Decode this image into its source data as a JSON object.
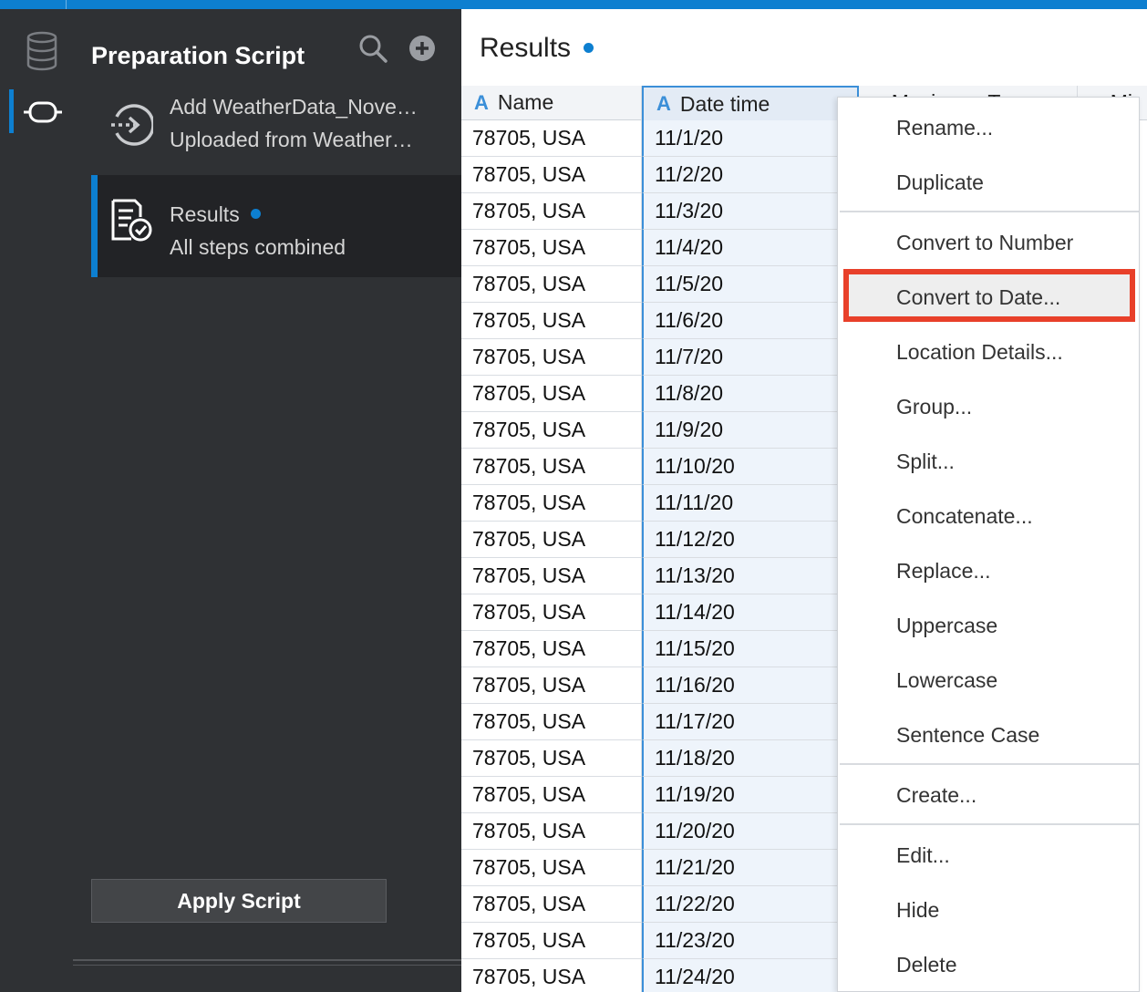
{
  "colors": {
    "accent": "#0d7fd0",
    "highlight": "#e8402a",
    "panel_bg": "#2f3134"
  },
  "left_rail": {
    "icons": [
      "database-icon",
      "data-flow-icon"
    ]
  },
  "script_panel": {
    "title": "Preparation Script",
    "steps": [
      {
        "title": "Add WeatherData_Nove…",
        "subtitle": "Uploaded from Weather…",
        "icon": "add-data-icon"
      },
      {
        "title": "Results",
        "subtitle": "All steps combined",
        "icon": "results-check-icon"
      }
    ],
    "apply_label": "Apply Script"
  },
  "main": {
    "title": "Results",
    "columns": [
      "Name",
      "Date time",
      "Maximum Temp",
      "Mi"
    ],
    "rows": [
      [
        "78705, USA",
        "11/1/20"
      ],
      [
        "78705, USA",
        "11/2/20"
      ],
      [
        "78705, USA",
        "11/3/20"
      ],
      [
        "78705, USA",
        "11/4/20"
      ],
      [
        "78705, USA",
        "11/5/20"
      ],
      [
        "78705, USA",
        "11/6/20"
      ],
      [
        "78705, USA",
        "11/7/20"
      ],
      [
        "78705, USA",
        "11/8/20"
      ],
      [
        "78705, USA",
        "11/9/20"
      ],
      [
        "78705, USA",
        "11/10/20"
      ],
      [
        "78705, USA",
        "11/11/20"
      ],
      [
        "78705, USA",
        "11/12/20"
      ],
      [
        "78705, USA",
        "11/13/20"
      ],
      [
        "78705, USA",
        "11/14/20"
      ],
      [
        "78705, USA",
        "11/15/20"
      ],
      [
        "78705, USA",
        "11/16/20"
      ],
      [
        "78705, USA",
        "11/17/20"
      ],
      [
        "78705, USA",
        "11/18/20"
      ],
      [
        "78705, USA",
        "11/19/20"
      ],
      [
        "78705, USA",
        "11/20/20"
      ],
      [
        "78705, USA",
        "11/21/20"
      ],
      [
        "78705, USA",
        "11/22/20"
      ],
      [
        "78705, USA",
        "11/23/20"
      ],
      [
        "78705, USA",
        "11/24/20"
      ]
    ]
  },
  "context_menu": {
    "items": [
      "Rename...",
      "Duplicate",
      "Convert to Number",
      "Convert to Date...",
      "Location Details...",
      "Group...",
      "Split...",
      "Concatenate...",
      "Replace...",
      "Uppercase",
      "Lowercase",
      "Sentence Case",
      "Create...",
      "Edit...",
      "Hide",
      "Delete"
    ],
    "highlighted": "Convert to Date..."
  }
}
